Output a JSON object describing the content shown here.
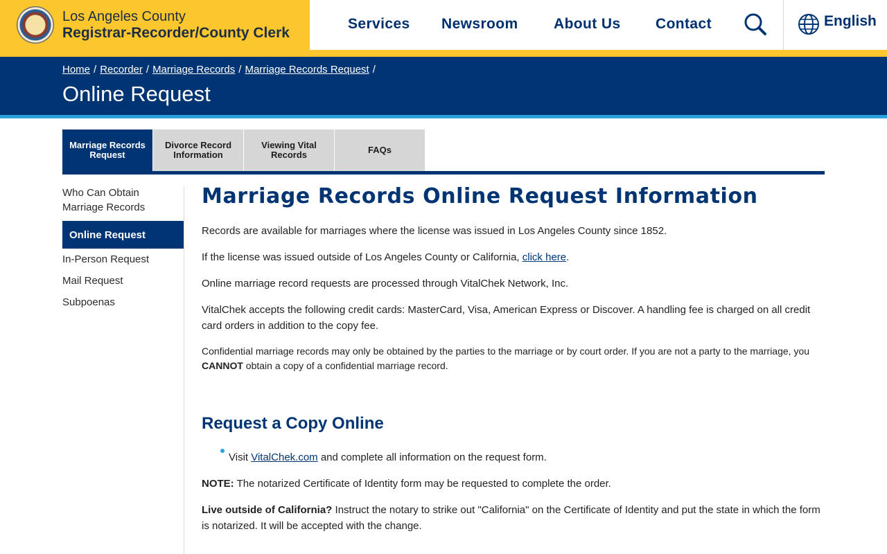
{
  "header": {
    "brand_line1": "Los Angeles County",
    "brand_line2": "Registrar-Recorder/County Clerk",
    "seal_icon": "county-seal-icon",
    "nav": [
      {
        "label": "Services"
      },
      {
        "label": "Newsroom"
      },
      {
        "label": "About Us"
      },
      {
        "label": "Contact"
      }
    ],
    "search_icon": "search-icon",
    "language_icon": "globe-icon",
    "language_label": "English"
  },
  "breadcrumb": [
    {
      "label": "Home"
    },
    {
      "label": "Recorder"
    },
    {
      "label": "Marriage Records"
    },
    {
      "label": "Marriage Records Request"
    }
  ],
  "breadcrumb_separator": "/",
  "page_title": "Online Request",
  "tabs": [
    {
      "label": "Marriage Records Request",
      "active": true
    },
    {
      "label": "Divorce Record Information",
      "active": false
    },
    {
      "label": "Viewing Vital Records",
      "active": false
    },
    {
      "label": "FAQs",
      "active": false
    }
  ],
  "sidebar": {
    "items": [
      {
        "label": "Who Can Obtain Marriage Records",
        "active": false
      },
      {
        "label": "Online Request",
        "active": true
      },
      {
        "label": "In-Person Request",
        "active": false
      },
      {
        "label": "Mail Request",
        "active": false
      },
      {
        "label": "Subpoenas",
        "active": false
      }
    ]
  },
  "main": {
    "heading": "Marriage Records Online Request Information",
    "p1": "Records are available for marriages where the license was issued in Los Angeles County since 1852.",
    "p2_before": "If the license was issued outside of Los Angeles County or California, ",
    "p2_link": "click here",
    "p2_after": ".",
    "p3": "Online marriage record requests are processed through VitalChek Network, Inc.",
    "p4": "VitalChek accepts the following credit cards: MasterCard, Visa, American Express or Discover. A  handling fee is charged on all credit card orders in addition to the copy fee.",
    "p5_before": "Confidential marriage records may only be obtained by the parties to the marriage or by court order. If you are not a party to the marriage, you ",
    "p5_strong": "CANNOT",
    "p5_after": " obtain a copy of a confidential marriage record.",
    "subheading": "Request a Copy Online",
    "bullet_before": "Visit ",
    "bullet_link": "VitalChek.com",
    "bullet_after": " and complete all information on the request form.",
    "note_label": "NOTE:",
    "note_text": " The notarized Certificate of Identity form may be requested to complete the order.",
    "outside_label": "Live outside of California?",
    "outside_text": " Instruct the notary to strike out \"California\" on the Certificate of Identity and put the state in which the form is notarized. It will be accepted with the change."
  },
  "colors": {
    "brand_yellow": "#fcc72c",
    "navy": "#003472",
    "accent_blue": "#2aa3dd",
    "tab_gray": "#d6d6d6"
  }
}
